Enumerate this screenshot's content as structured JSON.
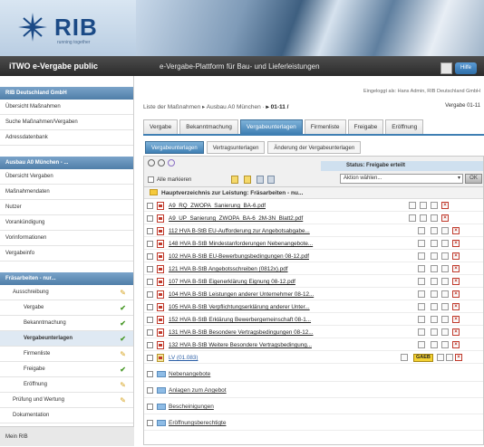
{
  "header": {
    "logo_text": "RIB",
    "tagline": "running together",
    "product": "iTWO e-Vergabe public",
    "subtitle": "e-Vergabe-Plattform für Bau- und Lieferleistungen",
    "help_label": "Hilfe"
  },
  "sidebar": {
    "section1": "RIB Deutschland GmbH",
    "items1": [
      "Übersicht Maßnahmen",
      "Suche Maßnahmen/Vergaben",
      "Adressdatenbank"
    ],
    "section2": "Ausbau A0 München - ...",
    "items2": [
      "Übersicht Vergaben",
      "Maßnahmendaten",
      "Nutzer",
      "Vorankündigung",
      "Vorinformationen",
      "Vergabeinfo"
    ],
    "section3": "Fräsarbeiten - nur...",
    "tree": [
      {
        "label": "Ausschreibung",
        "level": 1,
        "state": "pen"
      },
      {
        "label": "Vergabe",
        "level": 2,
        "state": "check"
      },
      {
        "label": "Bekanntmachung",
        "level": 2,
        "state": "check"
      },
      {
        "label": "Vergabeunterlagen",
        "level": 2,
        "state": "check",
        "selected": true
      },
      {
        "label": "Firmenliste",
        "level": 2,
        "state": "pen"
      },
      {
        "label": "Freigabe",
        "level": 2,
        "state": "check"
      },
      {
        "label": "Eröffnung",
        "level": 2,
        "state": "pen"
      },
      {
        "label": "Prüfung und Wertung",
        "level": 1,
        "state": "pen"
      },
      {
        "label": "Dokumentation",
        "level": 1,
        "state": ""
      },
      {
        "label": "Aufhebung",
        "level": 1,
        "state": ""
      }
    ],
    "footer": "Mein RIB"
  },
  "main": {
    "login": "Eingeloggt als: Hans Admin, RIB Deutschland GmbH",
    "breadcrumb": "Liste der Maßnahmen ▸ Ausbau A0 München ·",
    "breadcrumb_current": "▸ 01-11 /",
    "vergabe": "Vergabe 01-11",
    "tabs": [
      "Vergabe",
      "Bekanntmachung",
      "Vergabeunterlagen",
      "Firmenliste",
      "Freigabe",
      "Eröffnung"
    ],
    "active_tab": "Vergabeunterlagen",
    "subtabs": [
      "Vergabeunterlagen",
      "Vertragsunterlagen",
      "Änderung der Vergabeunterlagen"
    ],
    "select_all": "Alle markieren",
    "status": "Status: Freigabe erteilt",
    "action_select": "Aktion wählen...",
    "ok": "OK",
    "main_folder": "Hauptverzeichnis zur Leistung: Fräsarbeiten - nu...",
    "files": [
      "A9_RQ_ZWOPA_Sanierung_BA-6.pdf",
      "A9_UP_Sanierung_ZWOPA_BA-6_2M-3N_Blatt2.pdf",
      "112 HVA B-StB EU-Aufforderung zur Angebotsabgabe...",
      "148 HVA B-StB Mindestanforderungen Nebenangebote...",
      "102 HVA B-StB EU-Bewerbungsbedingungen 08-12.pdf",
      "121 HVA B-StB Angebotsschreiben (0812x).pdf",
      "107 HVA B-StB Eigenerklärung Eignung 08-12.pdf",
      "104 HVA B-StB Leistungen anderer Unternehmer 08-12...",
      "105 HVA B-StB Verpflichtungserklärung anderer Unter...",
      "152 HVA B-StB Erklärung Bewerbergemeinschaft 08-1...",
      "131 HVA B-StB Besondere Vertragsbedingungen 08-12...",
      "132 HVA B-StB Weitere Besondere Vertragsbedingung..."
    ],
    "lv_file": "LV (01.083)",
    "gaeb": "GAEB",
    "folders": [
      "Nebenangebote",
      "Anlagen zum Angebot",
      "Bescheinigungen",
      "Eröffnungsberechtigte"
    ]
  }
}
